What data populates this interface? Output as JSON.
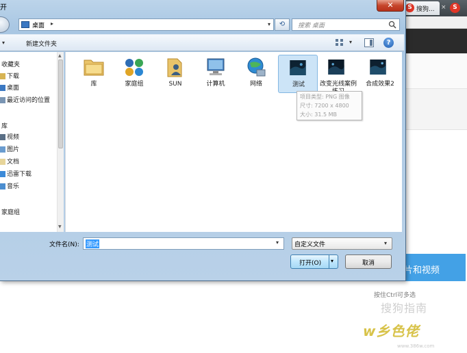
{
  "background": {
    "browser_tab_label": "搜狗...",
    "browser_tab_logo": "S",
    "browser_tab_close": "×",
    "browser_red_logo": "S",
    "upload_button_label": "片和视频",
    "multi_select_hint": "按住Ctrl可多选",
    "watermark_cn": "搜狗指南",
    "watermark_brand": "w乡色佬",
    "watermark_url": "www.386w.com"
  },
  "dialog": {
    "title_char": "开",
    "close_symbol": "✕",
    "address": {
      "location": "桌面",
      "separator": "▸",
      "dropdown": "▾"
    },
    "refresh_symbol": "⟲",
    "search": {
      "placeholder": "搜索 桌面"
    },
    "toolbar": {
      "organize_arrow": "▾",
      "new_folder_label": "新建文件夹",
      "view_arrow": "▾",
      "help_label": "?"
    },
    "nav_items": [
      {
        "label": "收藏夹",
        "icon": "star-icon"
      },
      {
        "label": "下载",
        "icon": "download-folder-icon"
      },
      {
        "label": "桌面",
        "icon": "desktop-icon"
      },
      {
        "label": "最近访问的位置",
        "icon": "recent-places-icon"
      },
      {
        "label": "库",
        "icon": "library-icon"
      },
      {
        "label": "视频",
        "icon": "video-library-icon"
      },
      {
        "label": "图片",
        "icon": "picture-library-icon"
      },
      {
        "label": "文档",
        "icon": "document-library-icon"
      },
      {
        "label": "迅雷下载",
        "icon": "thunder-download-icon"
      },
      {
        "label": "音乐",
        "icon": "music-library-icon"
      },
      {
        "label": "家庭组",
        "icon": "homegroup-icon"
      }
    ],
    "files": [
      {
        "label": "库",
        "icon": "library-folder-icon"
      },
      {
        "label": "家庭组",
        "icon": "homegroup-icon"
      },
      {
        "label": "SUN",
        "icon": "user-folder-icon"
      },
      {
        "label": "计算机",
        "icon": "computer-icon"
      },
      {
        "label": "网络",
        "icon": "network-icon"
      },
      {
        "label": "测试",
        "icon": "image-thumbnail-icon",
        "selected": true
      },
      {
        "label": "改变光线案例练习",
        "icon": "image-thumbnail-icon"
      },
      {
        "label": "合成效果2",
        "icon": "image-thumbnail-icon"
      }
    ],
    "tooltip": {
      "type": "项目类型: PNG 图像",
      "dimensions": "尺寸: 7200 x 4800",
      "size": "大小: 31.5 MB"
    },
    "filename": {
      "label": "文件名(N):",
      "value": "测试",
      "dropdown": "▾"
    },
    "filetype": {
      "value": "自定义文件",
      "arrow": "▾"
    },
    "open_button": {
      "label": "打开(O)",
      "arrow": "▾"
    },
    "cancel_button": {
      "label": "取消"
    }
  }
}
